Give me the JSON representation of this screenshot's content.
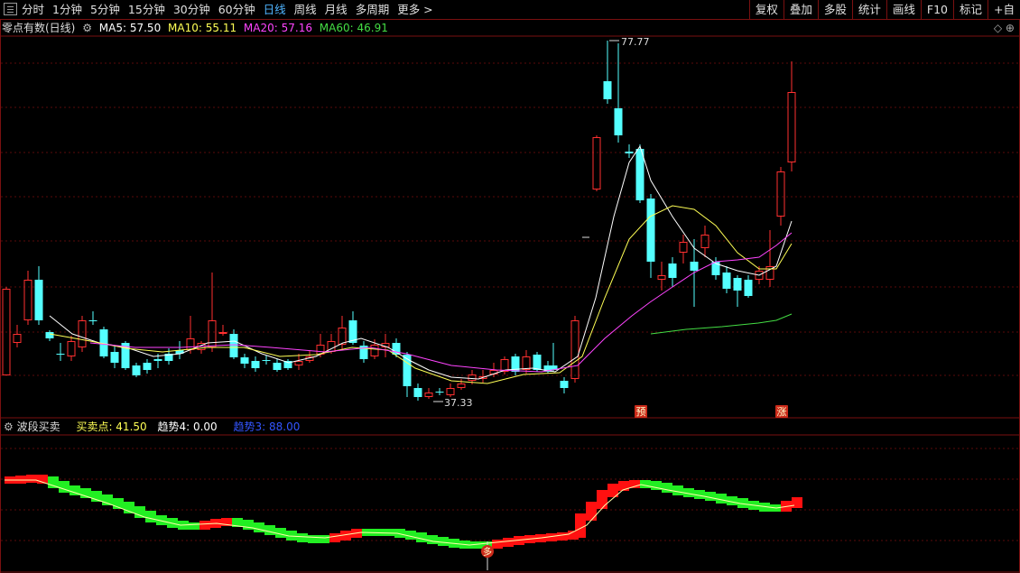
{
  "toolbar": {
    "tabs": [
      {
        "label": "分时",
        "active": false
      },
      {
        "label": "1分钟",
        "active": false
      },
      {
        "label": "5分钟",
        "active": false
      },
      {
        "label": "15分钟",
        "active": false
      },
      {
        "label": "30分钟",
        "active": false
      },
      {
        "label": "60分钟",
        "active": false
      },
      {
        "label": "日线",
        "active": true
      },
      {
        "label": "周线",
        "active": false
      },
      {
        "label": "月线",
        "active": false
      },
      {
        "label": "多周期",
        "active": false
      },
      {
        "label": "更多 >",
        "active": false
      }
    ],
    "tools": [
      "复权",
      "叠加",
      "多股",
      "统计",
      "画线",
      "F10",
      "标记",
      "+自"
    ]
  },
  "main_info": {
    "name": "零点有数(日线)",
    "ma5": "MA5: 57.50",
    "ma10": "MA10: 55.11",
    "ma20": "MA20: 57.16",
    "ma60": "MA60: 46.91",
    "colors": {
      "ma5": "#ffffff",
      "ma10": "#ffff55",
      "ma20": "#ff44ff",
      "ma60": "#44dd44"
    }
  },
  "price_labels": {
    "high": "77.77",
    "low": "37.33"
  },
  "signals": {
    "yu": "预",
    "zhang": "涨",
    "duo": "多"
  },
  "lower_info": {
    "name": "波段买卖",
    "buy_sell": "买卖点: 41.50",
    "trend4": "趋势4: 0.00",
    "trend3": "趋势3: 88.00"
  },
  "corner_icons": "◇ ⊕",
  "chart_data": {
    "type": "candlestick",
    "series": [
      {
        "name": "MA5",
        "color": "#ffffff"
      },
      {
        "name": "MA10",
        "color": "#ffff55"
      },
      {
        "name": "MA20",
        "color": "#ff44ff"
      },
      {
        "name": "MA60",
        "color": "#44dd44"
      }
    ],
    "price_high": 77.77,
    "price_low": 37.33
  }
}
